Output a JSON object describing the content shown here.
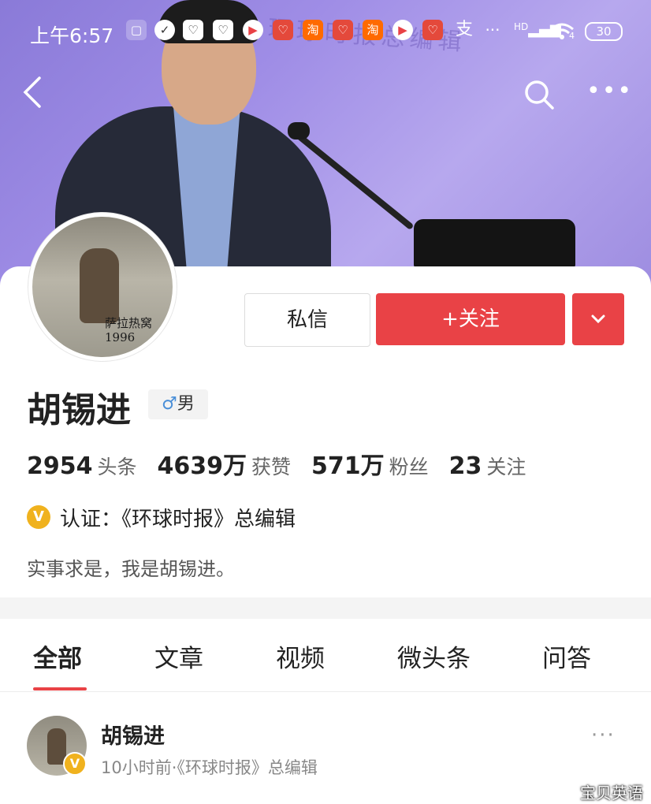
{
  "status_bar": {
    "time": "上午6:57",
    "network": "HD",
    "wifi_badge": "4",
    "battery": "30",
    "icons": [
      "mi-icon",
      "check-icon",
      "app-heart-icon",
      "app-heart-icon",
      "video-icon",
      "app-heart-icon",
      "taobao-icon",
      "app-heart-icon",
      "taobao-icon",
      "video-icon",
      "app-heart-icon",
      "alipay-icon"
    ],
    "overflow": "···"
  },
  "header": {
    "back_icon": "chevron-left-icon",
    "search_icon": "search-icon",
    "more_icon": "more-icon",
    "banner_text": "环球时报总编辑"
  },
  "profile": {
    "avatar_caption": "萨拉热窝 1996",
    "name": "胡锡进",
    "gender_symbol": "♂",
    "gender": "男",
    "message_label": "私信",
    "follow_label": "+关注",
    "stats": [
      {
        "value": "2954",
        "label": "头条"
      },
      {
        "value": "4639万",
        "label": "获赞"
      },
      {
        "value": "571万",
        "label": "粉丝"
      },
      {
        "value": "23",
        "label": "关注"
      }
    ],
    "verify_badge": "V",
    "verification": "认证：《环球时报》总编辑",
    "bio": "实事求是，我是胡锡进。"
  },
  "tabs": [
    {
      "label": "全部",
      "active": true
    },
    {
      "label": "文章"
    },
    {
      "label": "视频"
    },
    {
      "label": "微头条"
    },
    {
      "label": "问答"
    }
  ],
  "post": {
    "author": "胡锡进",
    "meta": "10小时前·《环球时报》总编辑",
    "more": "···",
    "badge": "V"
  },
  "watermark": "宝贝英语",
  "colors": {
    "accent": "#e94246",
    "verify": "#f0b21e",
    "hero": "#9f8de6"
  }
}
